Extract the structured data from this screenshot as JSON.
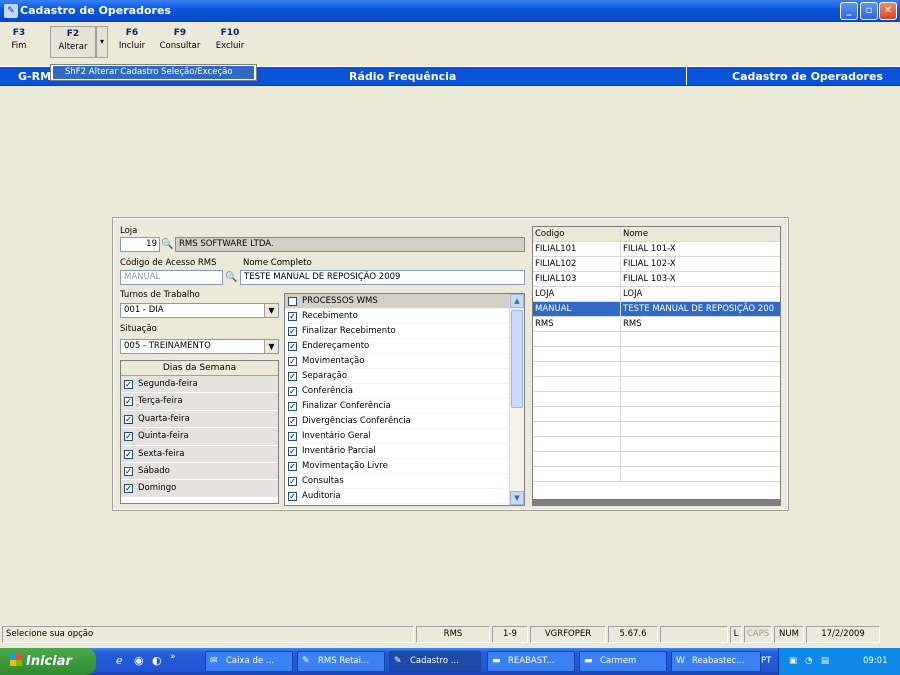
{
  "window": {
    "title": "Cadastro de Operadores"
  },
  "toolbar": [
    {
      "key": "F3",
      "label": "Fim"
    },
    {
      "key": "F2",
      "label": "Alterar"
    },
    {
      "key": "F6",
      "label": "Incluir"
    },
    {
      "key": "F9",
      "label": "Consultar"
    },
    {
      "key": "F10",
      "label": "Excluir"
    }
  ],
  "dropdown_menu": {
    "item": "ShF2  Alterar Cadastro Seleção/Exceção"
  },
  "header_bar": {
    "left": "G-RM",
    "center": "Rádio Frequência",
    "right": "Cadastro de Operadores"
  },
  "form": {
    "loja_label": "Loja",
    "loja_code": "19",
    "loja_name": "RMS SOFTWARE LTDA.",
    "codigo_label": "Código de Acesso RMS",
    "codigo_value": "MANUAL",
    "nome_label": "Nome Completo",
    "nome_value": "TESTE MANUAL DE REPOSIÇÃO 2009",
    "turnos_label": "Turnos de Trabalho",
    "turnos_value": "001 - DIA",
    "situacao_label": "Situação",
    "situacao_value": "005 - TREINAMENTO"
  },
  "dias": {
    "header": "Dias da Semana",
    "items": [
      {
        "label": "Segunda-feira",
        "checked": true
      },
      {
        "label": "Terça-feira",
        "checked": true
      },
      {
        "label": "Quarta-feira",
        "checked": true
      },
      {
        "label": "Quinta-feira",
        "checked": true
      },
      {
        "label": "Sexta-feira",
        "checked": true
      },
      {
        "label": "Sábado",
        "checked": true
      },
      {
        "label": "Domingo",
        "checked": true
      }
    ]
  },
  "processos": {
    "header": "PROCESSOS WMS",
    "items": [
      {
        "label": "Recebimento",
        "checked": true
      },
      {
        "label": "Finalizar Recebimento",
        "checked": true
      },
      {
        "label": "Endereçamento",
        "checked": true
      },
      {
        "label": "Movimentação",
        "checked": true
      },
      {
        "label": "Separação",
        "checked": true
      },
      {
        "label": "Conferência",
        "checked": true
      },
      {
        "label": "Finalizar Conferência",
        "checked": true
      },
      {
        "label": "Divergências Conferência",
        "checked": true
      },
      {
        "label": "Inventário Geral",
        "checked": true
      },
      {
        "label": "Inventário Parcial",
        "checked": true
      },
      {
        "label": "Movimentação Livre",
        "checked": true
      },
      {
        "label": "Consultas",
        "checked": true
      },
      {
        "label": "Auditoria",
        "checked": true
      }
    ]
  },
  "grid": {
    "columns": [
      "Codigo",
      "Nome"
    ],
    "rows": [
      [
        "FILIAL101",
        "FILIAL 101-X"
      ],
      [
        "FILIAL102",
        "FILIAL 102-X"
      ],
      [
        "FILIAL103",
        "FILIAL 103-X"
      ],
      [
        "LOJA",
        "LOJA"
      ],
      [
        "MANUAL",
        "TESTE MANUAL DE REPOSIÇÃO 200"
      ],
      [
        "RMS",
        "RMS"
      ]
    ],
    "selected_row": 4
  },
  "statusbar": {
    "message": "Selecione sua opção",
    "app": "RMS",
    "range": "1-9",
    "program": "VGRFOPER",
    "version": "5.67.6",
    "l": "L",
    "caps": "CAPS",
    "num": "NUM",
    "date": "17/2/2009"
  },
  "taskbar": {
    "start": "Iniciar",
    "tasks": [
      "Caixa de ...",
      "RMS Retai...",
      "Cadastro ...",
      "REABAST...",
      "Carmem",
      "Reabastec..."
    ],
    "lang": "PT",
    "time": "09:01"
  }
}
